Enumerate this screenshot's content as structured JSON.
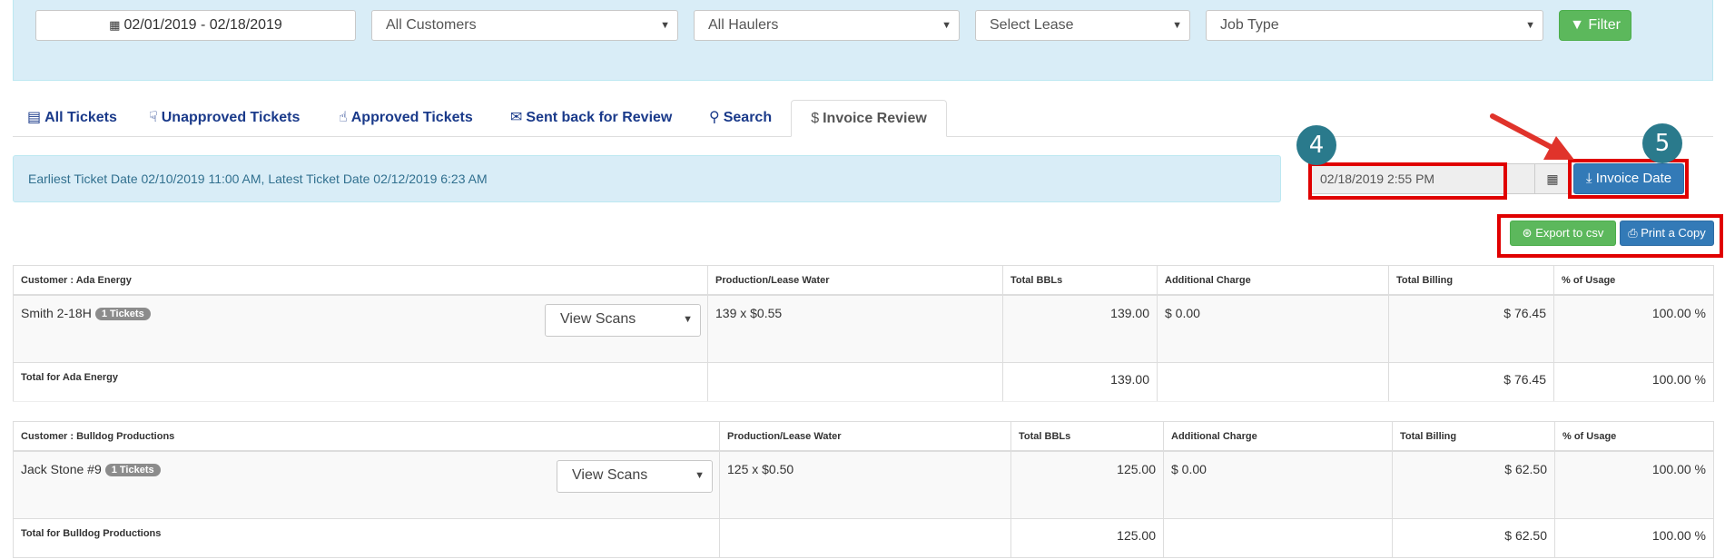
{
  "filters": {
    "date_range": "02/01/2019 - 02/18/2019",
    "customers": "All Customers",
    "haulers": "All Haulers",
    "lease": "Select Lease",
    "job_type": "Job Type",
    "filter_label": "Filter"
  },
  "tabs": [
    {
      "label": "All Tickets"
    },
    {
      "label": "Unapproved Tickets"
    },
    {
      "label": "Approved Tickets"
    },
    {
      "label": "Sent back for Review"
    },
    {
      "label": "Search"
    },
    {
      "label": "Invoice Review"
    }
  ],
  "info": {
    "text": "Earliest Ticket Date 02/10/2019 11:00 AM, Latest Ticket Date 02/12/2019 6:23 AM"
  },
  "invoice": {
    "date_value": "02/18/2019 2:55 PM",
    "invoice_date_label": "Invoice Date",
    "export_label": "Export to csv",
    "print_label": "Print a Copy"
  },
  "annotations": {
    "step4": "4",
    "step5": "5"
  },
  "columns": [
    "Production/Lease Water",
    "Total BBLs",
    "Additional Charge",
    "Total Billing",
    "% of Usage"
  ],
  "customers": [
    {
      "header": "Customer : Ada Energy",
      "well": "Smith 2-18H",
      "tickets": "1 Tickets",
      "scans_label": "View Scans",
      "production": "139 x $0.55",
      "bbls": "139.00",
      "additional": "$ 0.00",
      "billing": "$ 76.45",
      "usage": "100.00 %",
      "total_label": "Total for Ada Energy",
      "total_bbls": "139.00",
      "total_billing": "$ 76.45",
      "total_usage": "100.00 %"
    },
    {
      "header": "Customer : Bulldog Productions",
      "well": "Jack Stone #9",
      "tickets": "1 Tickets",
      "scans_label": "View Scans",
      "production": "125 x $0.50",
      "bbls": "125.00",
      "additional": "$ 0.00",
      "billing": "$ 62.50",
      "usage": "100.00 %",
      "total_label": "Total for Bulldog Productions",
      "total_bbls": "125.00",
      "total_billing": "$ 62.50",
      "total_usage": "100.00 %"
    }
  ]
}
